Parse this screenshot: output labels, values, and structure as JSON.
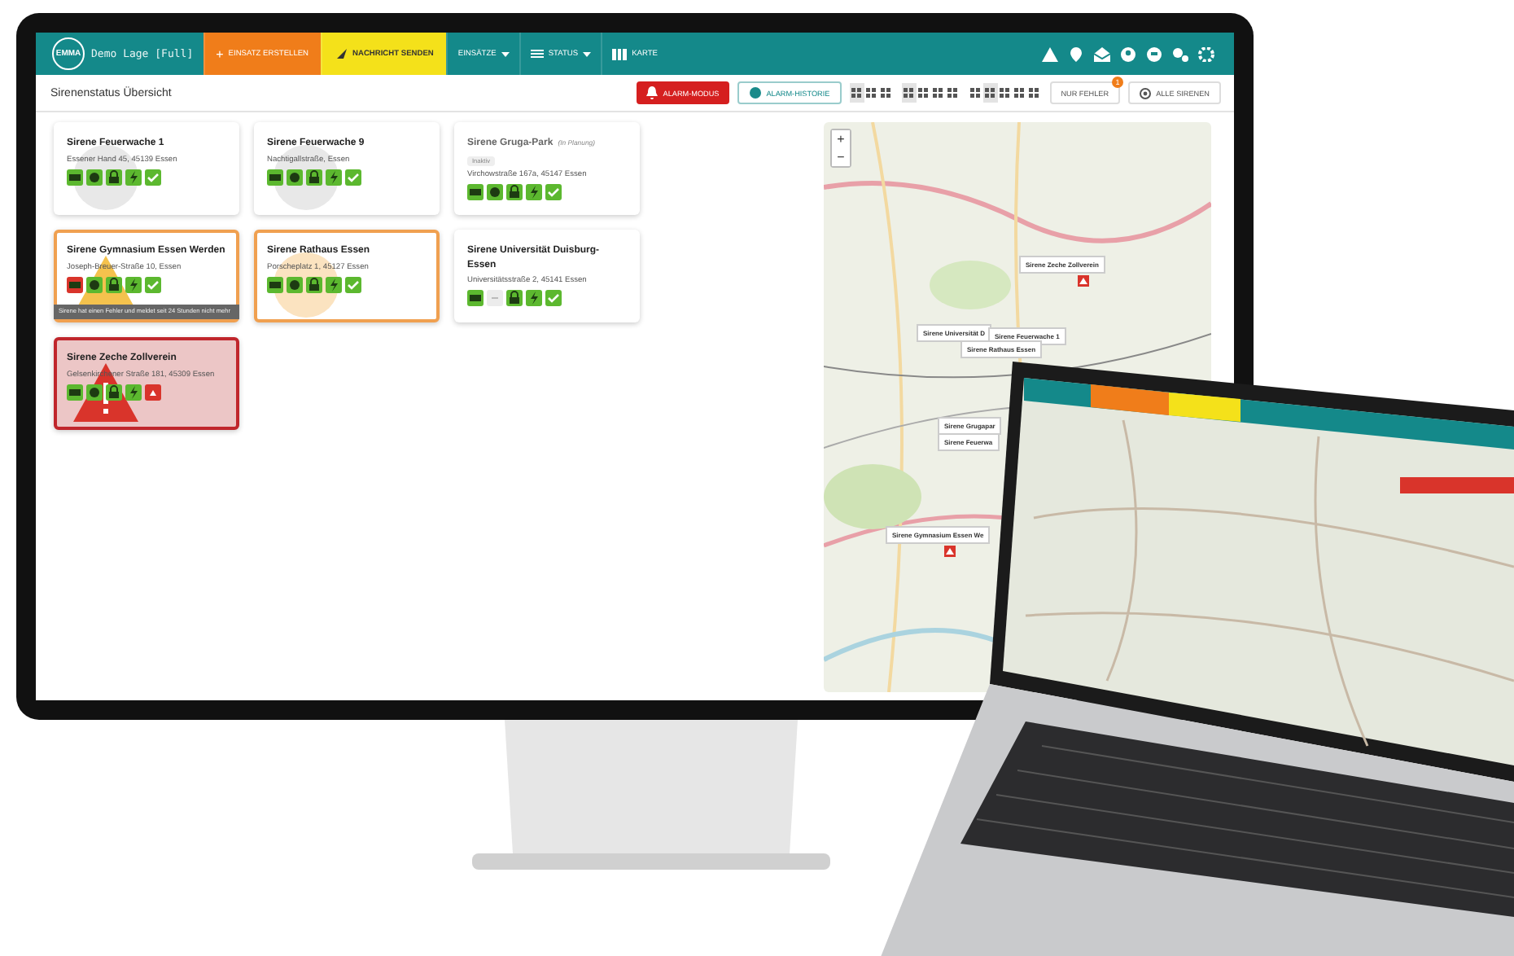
{
  "header": {
    "logo": "EMMA",
    "title": "Demo Lage [Full]",
    "nav": [
      {
        "kind": "create",
        "icon": "+",
        "label": "EINSATZ ERSTELLEN"
      },
      {
        "kind": "message",
        "label": "NACHRICHT SENDEN"
      },
      {
        "kind": "menu",
        "label": "EINSÄTZE"
      },
      {
        "kind": "menu",
        "label": "STATUS"
      },
      {
        "kind": "link",
        "label": "KARTE"
      }
    ]
  },
  "toolbar": {
    "title": "Sirenenstatus Übersicht",
    "alarm_button": "ALARM-MODUS",
    "history_button": "ALARM-HISTORIE",
    "view_toggles": [
      [
        {
          "selected": true
        },
        {
          "selected": false
        },
        {
          "selected": false
        }
      ],
      [
        {
          "selected": true
        },
        {
          "selected": false
        },
        {
          "selected": false
        },
        {
          "selected": false
        }
      ],
      [
        {
          "selected": false
        },
        {
          "selected": true
        },
        {
          "selected": false
        },
        {
          "selected": false
        },
        {
          "selected": false
        }
      ]
    ],
    "filter_button": "NUR FEHLER",
    "filter_badge": "1",
    "all_button": "ALLE SIRENEN"
  },
  "sirens": [
    {
      "name": "Sirene Feuerwache 1",
      "kind": "normal",
      "highlighted": true,
      "alert": false,
      "address": "Essener Hand 45, 45139 Essen",
      "icons": [
        {
          "kind": "battery",
          "color": "#5cb82f"
        },
        {
          "kind": "clock",
          "color": "#5cb82f"
        },
        {
          "kind": "lock",
          "color": "#5cb82f"
        },
        {
          "kind": "power",
          "color": "#5cb82f"
        },
        {
          "kind": "check",
          "color": "#5cb82f"
        }
      ]
    },
    {
      "name": "Sirene Feuerwache 9",
      "kind": "normal",
      "highlighted": true,
      "alert": false,
      "address": "Nachtigallstraße, Essen",
      "icons": [
        {
          "kind": "battery",
          "color": "#5cb82f"
        },
        {
          "kind": "clock",
          "color": "#5cb82f"
        },
        {
          "kind": "lock",
          "color": "#5cb82f"
        },
        {
          "kind": "power",
          "color": "#5cb82f"
        },
        {
          "kind": "check",
          "color": "#5cb82f"
        }
      ]
    },
    {
      "name": "Sirene Gruga-Park",
      "note": "(In Planung)",
      "tag": "Inaktiv",
      "kind": "planned",
      "highlighted": false,
      "alert": false,
      "address": "Virchowstraße 167a, 45147 Essen",
      "icons": [
        {
          "kind": "battery",
          "color": "#5cb82f"
        },
        {
          "kind": "clock",
          "color": "#5cb82f"
        },
        {
          "kind": "lock",
          "color": "#5cb82f"
        },
        {
          "kind": "power",
          "color": "#5cb82f"
        },
        {
          "kind": "check",
          "color": "#5cb82f"
        }
      ]
    },
    {
      "name": "Sirene Gymnasium Essen Werden",
      "kind": "warning",
      "highlighted": false,
      "alert": true,
      "address": "Joseph-Breuer-Straße 10, Essen",
      "tooltip": "Sirene hat einen Fehler und meldet seit 24 Stunden nicht mehr",
      "icons": [
        {
          "kind": "battery",
          "color": "#d9342b"
        },
        {
          "kind": "clock",
          "color": "#5cb82f"
        },
        {
          "kind": "lock",
          "color": "#5cb82f"
        },
        {
          "kind": "power",
          "color": "#5cb82f"
        },
        {
          "kind": "check",
          "color": "#5cb82f"
        }
      ]
    },
    {
      "name": "Sirene Rathaus Essen",
      "kind": "warning",
      "highlighted": true,
      "alert": false,
      "address": "Porscheplatz 1, 45127 Essen",
      "icons": [
        {
          "kind": "battery",
          "color": "#5cb82f"
        },
        {
          "kind": "clock",
          "color": "#5cb82f"
        },
        {
          "kind": "lock",
          "color": "#5cb82f"
        },
        {
          "kind": "power",
          "color": "#5cb82f"
        },
        {
          "kind": "check",
          "color": "#5cb82f"
        }
      ]
    },
    {
      "name": "Sirene Universität Duisburg-Essen",
      "kind": "normal",
      "highlighted": false,
      "alert": false,
      "address": "Universitätsstraße 2, 45141 Essen",
      "icons": [
        {
          "kind": "battery",
          "color": "#5cb82f"
        },
        {
          "kind": "empty",
          "color": "#ececec"
        },
        {
          "kind": "lock",
          "color": "#5cb82f"
        },
        {
          "kind": "power",
          "color": "#5cb82f"
        },
        {
          "kind": "check",
          "color": "#5cb82f"
        }
      ]
    },
    {
      "name": "Sirene Zeche Zollverein",
      "kind": "error",
      "highlighted": false,
      "alert": true,
      "address": "Gelsenkirchener Straße 181, 45309 Essen",
      "icons": [
        {
          "kind": "battery",
          "color": "#5cb82f"
        },
        {
          "kind": "clock",
          "color": "#5cb82f"
        },
        {
          "kind": "lock",
          "color": "#5cb82f"
        },
        {
          "kind": "power",
          "color": "#5cb82f"
        },
        {
          "kind": "alarm",
          "color": "#d9342b"
        }
      ]
    }
  ],
  "map": {
    "zoom_in": "+",
    "zoom_out": "−",
    "labels": [
      "Sirene Zeche Zollverein",
      "Sirene Universität D",
      "Sirene Feuerwache 1",
      "Sirene Rathaus Essen",
      "Sirene Grugapar",
      "Sirene Feuerwa",
      "Sirene Gymnasium Essen We"
    ]
  }
}
